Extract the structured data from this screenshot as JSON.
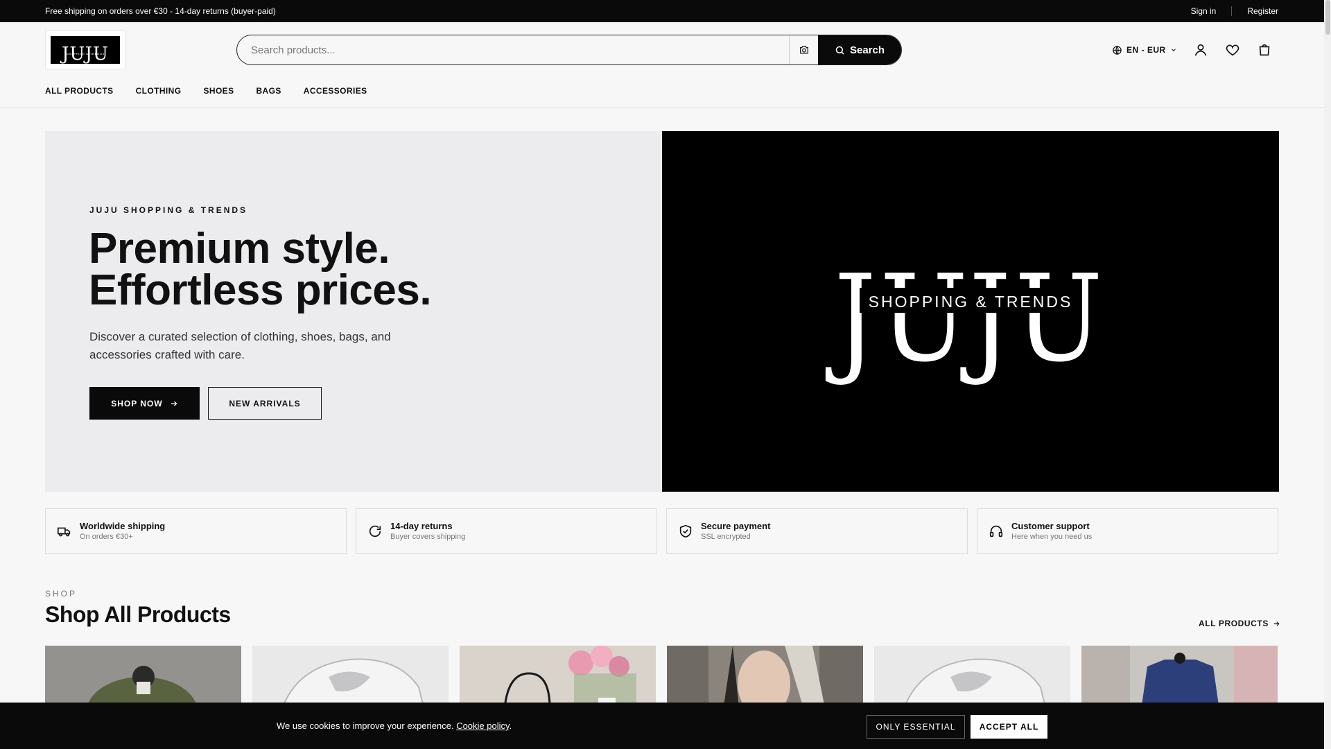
{
  "topbar": {
    "promo": "Free shipping on orders over €30 - 14-day returns (buyer-paid)",
    "sign_in": "Sign in",
    "register": "Register"
  },
  "header": {
    "logo_text": "JUJU",
    "logo_tagline": "SHOPPING & TRENDS",
    "search_placeholder": "Search products...",
    "search_button": "Search",
    "language_currency": "EN - EUR",
    "icons": [
      "camera-icon",
      "search-icon",
      "globe-icon",
      "chevron-down-icon",
      "user-icon",
      "heart-icon",
      "cart-icon"
    ]
  },
  "nav": {
    "items": [
      {
        "label": "ALL PRODUCTS"
      },
      {
        "label": "CLOTHING"
      },
      {
        "label": "SHOES"
      },
      {
        "label": "BAGS"
      },
      {
        "label": "ACCESSORIES"
      }
    ]
  },
  "hero": {
    "eyebrow": "JUJU SHOPPING & TRENDS",
    "title_line1": "Premium style.",
    "title_line2": "Effortless prices.",
    "description": "Discover a curated selection of clothing, shoes, bags, and accessories crafted with care.",
    "shop_now": "SHOP NOW",
    "new_arrivals": "NEW ARRIVALS",
    "brand_big": "JUJU",
    "brand_tagline": "SHOPPING & TRENDS"
  },
  "features": [
    {
      "icon": "truck-icon",
      "title": "Worldwide shipping",
      "subtitle": "On orders €30+"
    },
    {
      "icon": "refresh-icon",
      "title": "14-day returns",
      "subtitle": "Buyer covers shipping"
    },
    {
      "icon": "shield-icon",
      "title": "Secure payment",
      "subtitle": "SSL encrypted"
    },
    {
      "icon": "headphones-icon",
      "title": "Customer support",
      "subtitle": "Here when you need us"
    }
  ],
  "shop": {
    "eyebrow": "SHOP",
    "title": "Shop All Products",
    "all_link": "ALL PRODUCTS"
  },
  "cookie": {
    "message": "We use cookies to improve your experience.",
    "policy_link": "Cookie policy",
    "only_essential": "ONLY ESSENTIAL",
    "accept_all": "ACCEPT ALL"
  },
  "colors": {
    "primary": "#0a0a0a",
    "background": "#f7f7f7",
    "hero_panel": "#ececef"
  }
}
